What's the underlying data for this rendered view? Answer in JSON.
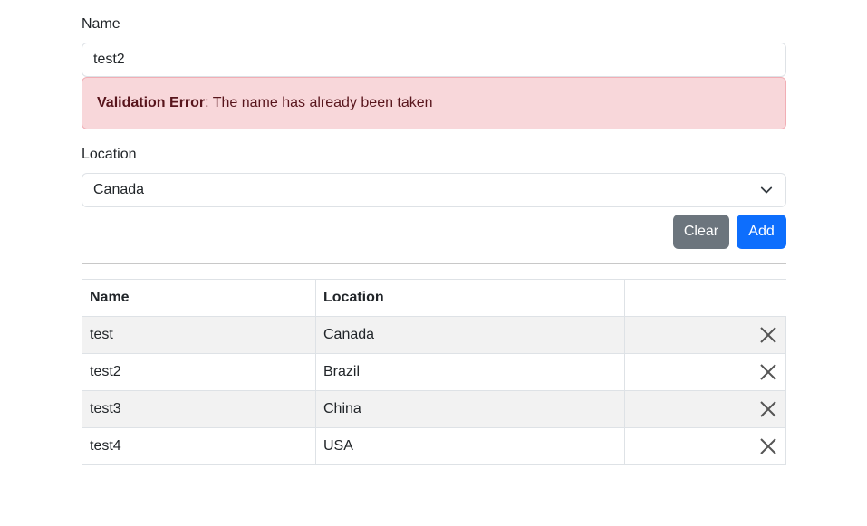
{
  "form": {
    "name_label": "Name",
    "name_value": "test2",
    "alert": {
      "title": "Validation Error",
      "message": ": The name has already been taken"
    },
    "location_label": "Location",
    "location_value": "Canada",
    "clear_label": "Clear",
    "add_label": "Add"
  },
  "table": {
    "headers": [
      "Name",
      "Location",
      ""
    ],
    "rows": [
      {
        "name": "test",
        "location": "Canada"
      },
      {
        "name": "test2",
        "location": "Brazil"
      },
      {
        "name": "test3",
        "location": "China"
      },
      {
        "name": "test4",
        "location": "USA"
      }
    ]
  },
  "colors": {
    "alert_bg": "#f8d7da",
    "alert_text": "#58151c",
    "clear_button": "#6c757d",
    "add_button": "#0d6efd"
  },
  "icons": {
    "select_caret": "chevron-down-icon",
    "row_delete": "close-icon"
  }
}
